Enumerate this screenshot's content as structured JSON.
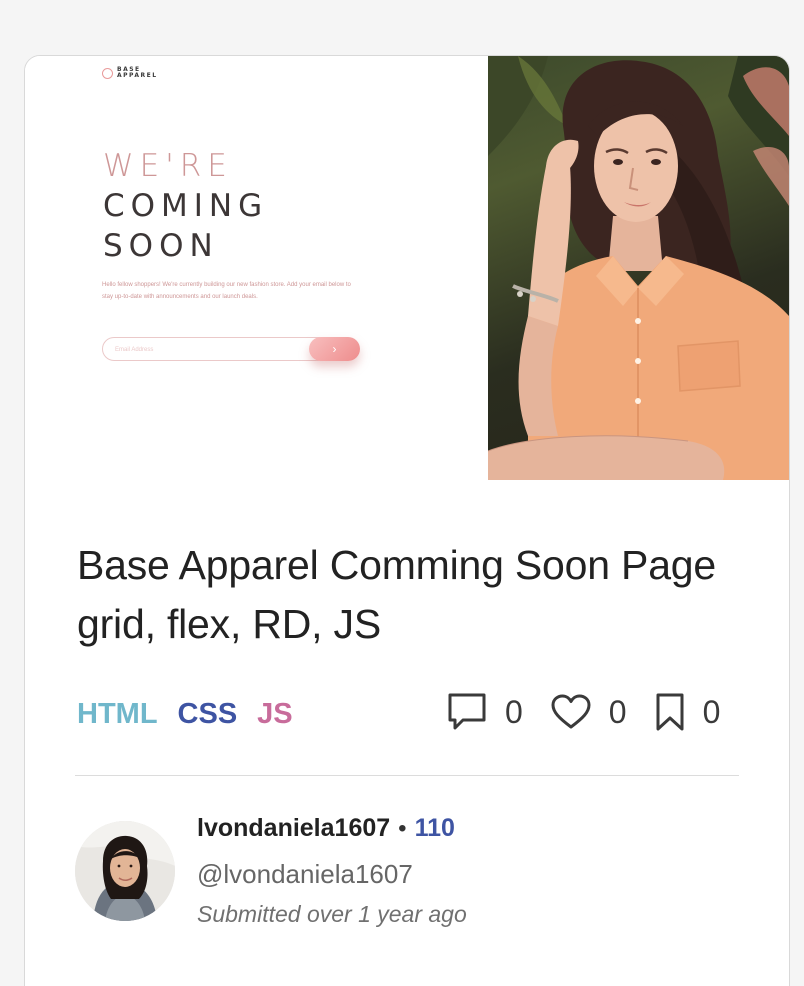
{
  "preview": {
    "logo_text": "BASE APPAREL",
    "headline_1": "WE'RE",
    "headline_2": "COMING",
    "headline_3": "SOON",
    "description": "Hello fellow shoppers! We're currently building our new fashion store. Add your email below to stay up-to-date with announcements and our launch deals.",
    "email_placeholder": "Email Address",
    "submit_glyph": "›"
  },
  "card": {
    "title": "Base Apparel Comming Soon Page grid, flex, RD, JS"
  },
  "tags": [
    "HTML",
    "CSS",
    "JS"
  ],
  "stats": {
    "comments": "0",
    "likes": "0",
    "bookmarks": "0"
  },
  "author": {
    "name": "lvondaniela1607",
    "separator": "•",
    "score": "110",
    "handle": "@lvondaniela1607",
    "submitted": "Submitted over 1 year ago"
  },
  "colors": {
    "html_tag": "#70b7cb",
    "css_tag": "#3e54a3",
    "js_tag": "#c86c9b",
    "score": "#3e54a3"
  }
}
